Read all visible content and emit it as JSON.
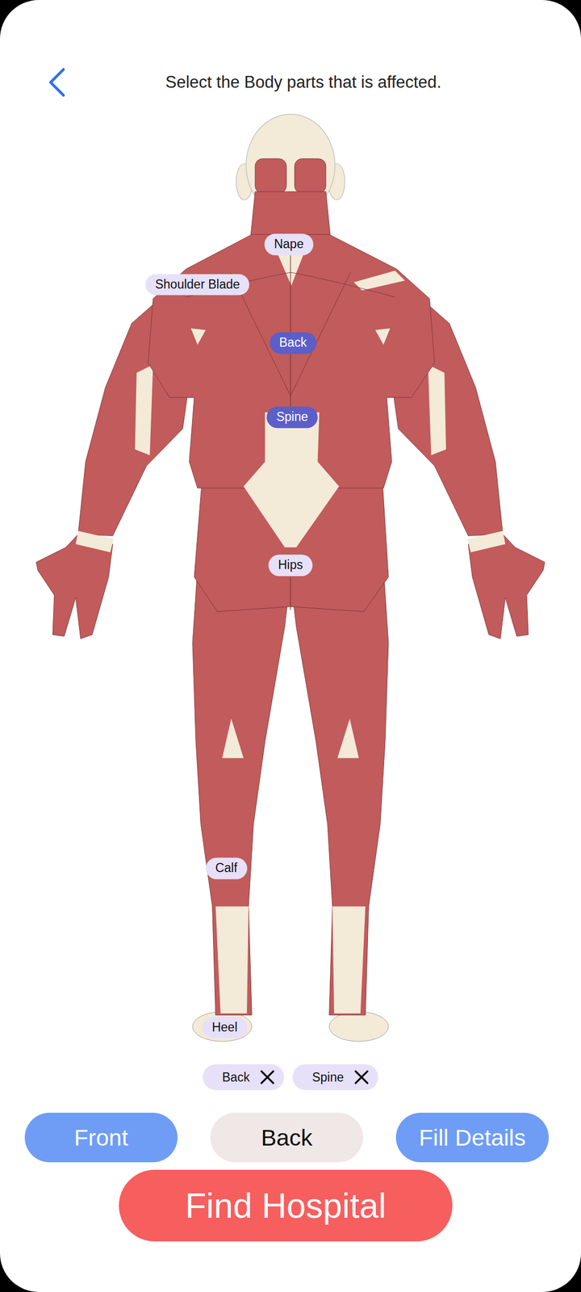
{
  "title": "Select the Body parts that is affected.",
  "body_parts": [
    {
      "label": "Nape",
      "selected": false
    },
    {
      "label": "Shoulder Blade",
      "selected": false
    },
    {
      "label": "Back",
      "selected": true
    },
    {
      "label": "Spine",
      "selected": true
    },
    {
      "label": "Hips",
      "selected": false
    },
    {
      "label": "Calf",
      "selected": false
    },
    {
      "label": "Heel",
      "selected": false
    }
  ],
  "selected_chips": [
    {
      "label": "Back"
    },
    {
      "label": "Spine"
    }
  ],
  "view_buttons": [
    {
      "label": "Front",
      "selected": false
    },
    {
      "label": "Back",
      "selected": true
    },
    {
      "label": "Fill Details",
      "selected": false
    }
  ],
  "primary_button": {
    "label": "Find Hospital"
  }
}
